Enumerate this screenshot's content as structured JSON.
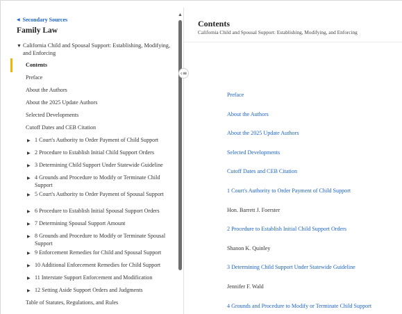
{
  "sidebar": {
    "breadcrumb": "Secondary Sources",
    "title": "Family Law",
    "book_title": "California Child and Spousal Support: Establishing, Modifying, and Enforcing",
    "items": [
      {
        "label": "Contents",
        "active": true,
        "expandable": false
      },
      {
        "label": "Preface",
        "active": false,
        "expandable": false
      },
      {
        "label": "About the Authors",
        "active": false,
        "expandable": false
      },
      {
        "label": "About the 2025 Update Authors",
        "active": false,
        "expandable": false
      },
      {
        "label": "Selected Developments",
        "active": false,
        "expandable": false
      },
      {
        "label": "Cutoff Dates and CEB Citation",
        "active": false,
        "expandable": false
      },
      {
        "label": "1 Court's Authority to Order Payment of Child Support",
        "active": false,
        "expandable": true
      },
      {
        "label": "2 Procedure to Establish Initial Child Support Orders",
        "active": false,
        "expandable": true
      },
      {
        "label": "3 Determining Child Support Under Statewide Guideline",
        "active": false,
        "expandable": true
      },
      {
        "label": "4 Grounds and Procedure to Modify or Terminate Child Support",
        "active": false,
        "expandable": true
      },
      {
        "label": "5 Court's Authority to Order Payment of Spousal Support",
        "active": false,
        "expandable": true
      },
      {
        "label": "6 Procedure to Establish Initial Spousal Support Orders",
        "active": false,
        "expandable": true
      },
      {
        "label": "7 Determining Spousal Support Amount",
        "active": false,
        "expandable": true
      },
      {
        "label": "8 Grounds and Procedure to Modify or Terminate Spousal Support",
        "active": false,
        "expandable": true
      },
      {
        "label": "9 Enforcement Remedies for Child and Spousal Support",
        "active": false,
        "expandable": true
      },
      {
        "label": "10 Additional Enforcement Remedies for Child Support",
        "active": false,
        "expandable": true
      },
      {
        "label": "11 Interstate Support Enforcement and Modification",
        "active": false,
        "expandable": true
      },
      {
        "label": "12 Setting Aside Support Orders and Judgments",
        "active": false,
        "expandable": true
      },
      {
        "label": "Table of Statutes, Regulations, and Rules",
        "active": false,
        "expandable": false
      }
    ]
  },
  "main": {
    "title": "Contents",
    "subtitle": "California Child and Spousal Support: Establishing, Modifying, and Enforcing",
    "rows": [
      {
        "text": "Preface",
        "kind": "link"
      },
      {
        "text": "About the Authors",
        "kind": "link"
      },
      {
        "text": "About the 2025 Update Authors",
        "kind": "link"
      },
      {
        "text": "Selected Developments",
        "kind": "link"
      },
      {
        "text": "Cutoff Dates and CEB Citation",
        "kind": "link"
      },
      {
        "text": "1 Court's Authority to Order Payment of Child Support",
        "kind": "link"
      },
      {
        "text": "Hon. Barrett J. Foerster",
        "kind": "author"
      },
      {
        "text": "2 Procedure to Establish Initial Child Support Orders",
        "kind": "link"
      },
      {
        "text": "Shanon K. Quinley",
        "kind": "author"
      },
      {
        "text": "3 Determining Child Support Under Statewide Guideline",
        "kind": "link"
      },
      {
        "text": "Jennifer F. Wald",
        "kind": "author"
      },
      {
        "text": "4 Grounds and Procedure to Modify or Terminate Child Support",
        "kind": "link"
      }
    ]
  },
  "icons": {
    "breadcrumb_chevron": "chevron-left-icon",
    "book_caret": "caret-down-icon",
    "item_caret": "caret-right-icon",
    "collapse": "collapse-panel-icon",
    "scroll_up": "scroll-up-icon"
  },
  "colors": {
    "link": "#1b63c6",
    "active_marker": "#f4b400",
    "scrollbar": "#6d6d6d"
  }
}
